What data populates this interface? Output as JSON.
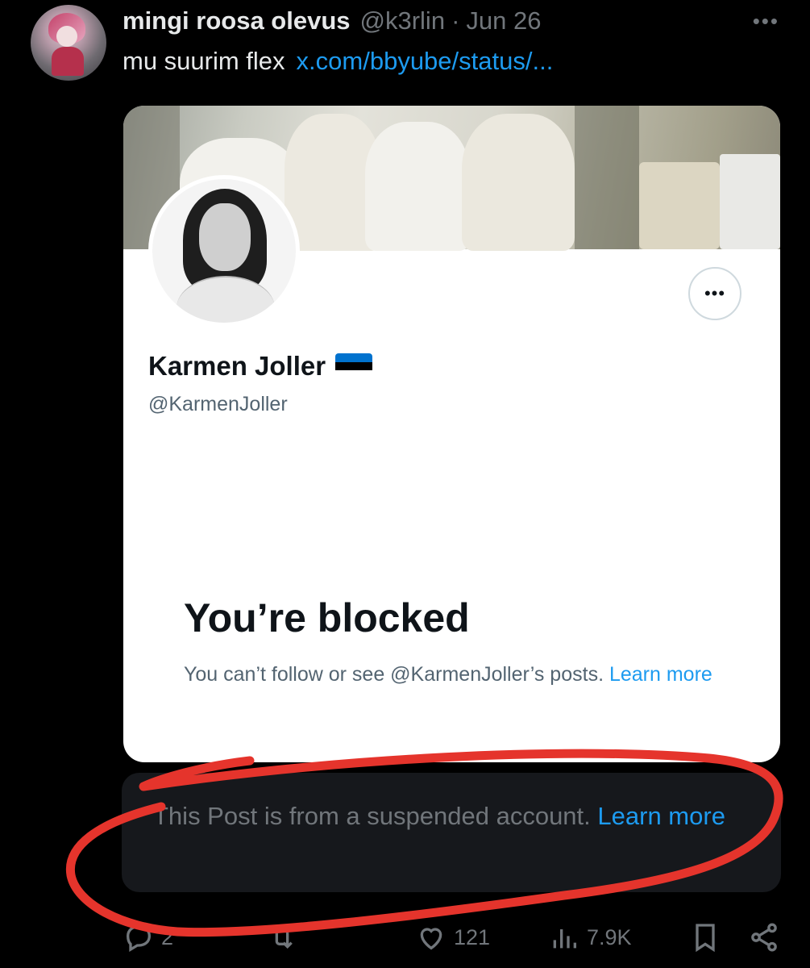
{
  "tweet": {
    "author_name": "mingi roosa olevus",
    "handle": "@k3rlin",
    "separator": "·",
    "date": "Jun 26",
    "more_icon": "more-horizontal-icon",
    "text": "mu suurim flex",
    "link_text": "x.com/bbyube/status/..."
  },
  "card": {
    "profile_name": "Karmen Joller",
    "flag_colors": [
      "#0072ce",
      "#000000",
      "#ffffff"
    ],
    "profile_handle": "@KarmenJoller",
    "more_icon": "more-horizontal-icon",
    "blocked_title": "You’re blocked",
    "blocked_text": "You can’t follow or see @KarmenJoller’s posts.",
    "learn_more": "Learn more"
  },
  "suspended_notice": {
    "text": "This Post is from a suspended account.",
    "learn_more": "Learn more"
  },
  "actions": {
    "replies": "2",
    "retweets": "",
    "likes": "121",
    "views": "7.9K",
    "icons": [
      "reply-icon",
      "retweet-icon",
      "like-icon",
      "views-icon",
      "bookmark-icon",
      "share-icon"
    ]
  },
  "colors": {
    "accent": "#1d9bf0",
    "annotation": "#e5342c",
    "muted": "#71767b"
  }
}
